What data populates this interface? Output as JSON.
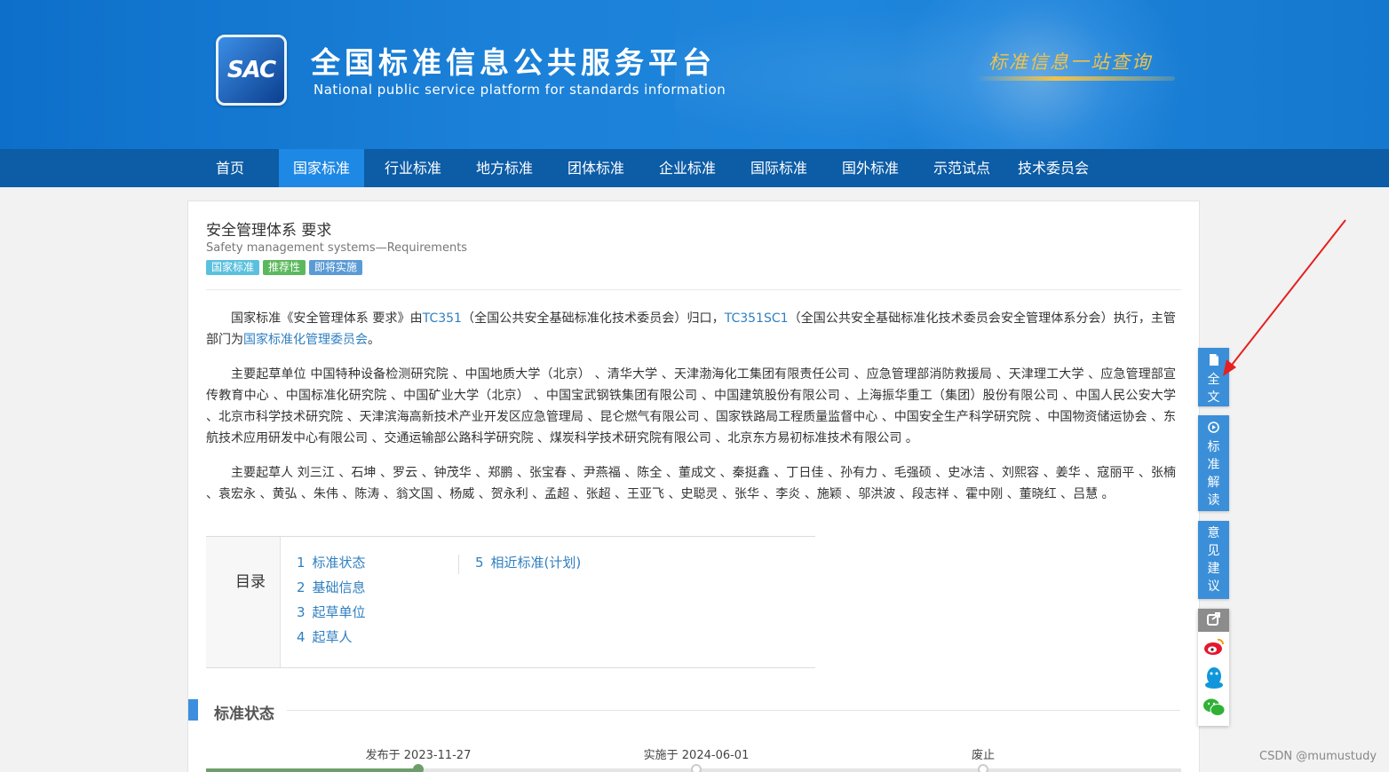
{
  "header": {
    "logo_text": "SAC",
    "title": "全国标准信息公共服务平台",
    "subtitle": "National public service platform  for standards information",
    "slogan": "标准信息一站查询"
  },
  "nav": {
    "items": [
      {
        "label": "首页",
        "active": false
      },
      {
        "label": "国家标准",
        "active": true
      },
      {
        "label": "行业标准",
        "active": false
      },
      {
        "label": "地方标准",
        "active": false
      },
      {
        "label": "团体标准",
        "active": false
      },
      {
        "label": "企业标准",
        "active": false
      },
      {
        "label": "国际标准",
        "active": false
      },
      {
        "label": "国外标准",
        "active": false
      },
      {
        "label": "示范试点",
        "active": false
      },
      {
        "label": "技术委员会",
        "active": false
      }
    ]
  },
  "standard": {
    "title": "安全管理体系 要求",
    "title_en": "Safety management systems—Requirements",
    "tags": [
      {
        "label": "国家标准",
        "color": "#5bc0de"
      },
      {
        "label": "推荐性",
        "color": "#5cb85c"
      },
      {
        "label": "即将实施",
        "color": "#5b9bd5"
      }
    ],
    "intro": {
      "p1": "国家标准《安全管理体系 要求》由",
      "tc1": "TC351",
      "p2": "（全国公共安全基础标准化技术委员会）归口，",
      "tc2": "TC351SC1",
      "p3": "（全国公共安全基础标准化技术委员会安全管理体系分会）执行，主管部门为",
      "dept": "国家标准化管理委员会",
      "p4": "。"
    },
    "drafting_units": "主要起草单位 中国特种设备检测研究院 、中国地质大学（北京） 、清华大学 、天津渤海化工集团有限责任公司 、应急管理部消防救援局 、天津理工大学 、应急管理部宣传教育中心 、中国标准化研究院 、中国矿业大学（北京） 、中国宝武钢铁集团有限公司 、中国建筑股份有限公司 、上海振华重工（集团）股份有限公司 、中国人民公安大学 、北京市科学技术研究院 、天津滨海高新技术产业开发区应急管理局 、昆仑燃气有限公司 、国家铁路局工程质量监督中心 、中国安全生产科学研究院 、中国物资储运协会 、东航技术应用研发中心有限公司 、交通运输部公路科学研究院 、煤炭科学技术研究院有限公司 、北京东方易初标准技术有限公司 。",
    "drafters": "主要起草人 刘三江 、石坤 、罗云 、钟茂华 、郑鹏 、张宝春 、尹燕福 、陈全 、董成文 、秦挺鑫 、丁日佳 、孙有力 、毛强硕 、史冰洁 、刘熙容 、姜华 、寇丽平 、张楠 、袁宏永 、黄弘 、朱伟 、陈涛 、翁文国 、杨威 、贺永利 、孟超 、张超 、王亚飞 、史聪灵 、张华 、李炎 、施颖 、邬洪波 、段志祥 、霍中刚 、董晓红 、吕慧 。"
  },
  "toc": {
    "heading": "目录",
    "items": [
      {
        "num": "1",
        "label": "标准状态"
      },
      {
        "num": "2",
        "label": "基础信息"
      },
      {
        "num": "3",
        "label": "起草单位"
      },
      {
        "num": "4",
        "label": "起草人"
      },
      {
        "num": "5",
        "label": "相近标准(计划)"
      }
    ]
  },
  "status_section": {
    "title": "标准状态",
    "timeline": [
      {
        "label": "发布于 2023-11-27",
        "done": true
      },
      {
        "label": "实施于 2024-06-01",
        "done": false
      },
      {
        "label": "废止",
        "done": false
      }
    ],
    "progress": 0.22
  },
  "side_toolbar": {
    "fulltext": "全文",
    "interpretation": "标准解读",
    "feedback": "意见建议",
    "share_icons": [
      "share-icon",
      "weibo-icon",
      "qq-icon",
      "wechat-icon"
    ]
  },
  "watermark": "CSDN @mumustudy"
}
